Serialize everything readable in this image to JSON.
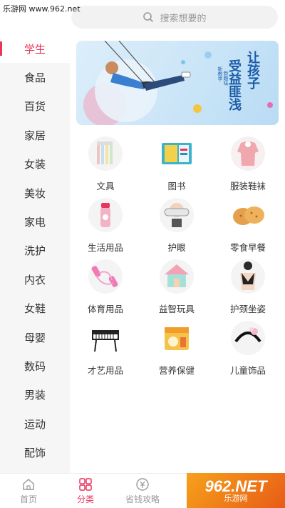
{
  "watermark_top": "乐游网 www.962.net",
  "search": {
    "placeholder": "搜索想要的"
  },
  "sidebar": {
    "items": [
      {
        "label": "学生",
        "active": true
      },
      {
        "label": "食品"
      },
      {
        "label": "百货"
      },
      {
        "label": "家居"
      },
      {
        "label": "女装"
      },
      {
        "label": "美妆"
      },
      {
        "label": "家电"
      },
      {
        "label": "洗护"
      },
      {
        "label": "内衣"
      },
      {
        "label": "女鞋"
      },
      {
        "label": "母婴"
      },
      {
        "label": "数码"
      },
      {
        "label": "男装"
      },
      {
        "label": "运动"
      },
      {
        "label": "配饰"
      }
    ]
  },
  "banner": {
    "line1": "让孩子",
    "line2": "受益匪浅",
    "small1": "新教学",
    "small2": "新趣味"
  },
  "categories": [
    {
      "label": "文具",
      "icon": "pens-icon"
    },
    {
      "label": "图书",
      "icon": "books-icon"
    },
    {
      "label": "服装鞋袜",
      "icon": "coat-icon"
    },
    {
      "label": "生活用品",
      "icon": "bottle-icon"
    },
    {
      "label": "护眼",
      "icon": "eye-massager-icon"
    },
    {
      "label": "零食早餐",
      "icon": "biscuits-icon"
    },
    {
      "label": "体育用品",
      "icon": "jump-rope-icon"
    },
    {
      "label": "益智玩具",
      "icon": "toy-house-icon"
    },
    {
      "label": "护颈坐姿",
      "icon": "posture-brace-icon"
    },
    {
      "label": "才艺用品",
      "icon": "keyboard-icon"
    },
    {
      "label": "营养保健",
      "icon": "milk-powder-icon"
    },
    {
      "label": "儿童饰品",
      "icon": "headband-icon"
    }
  ],
  "tabbar": {
    "tabs": [
      {
        "label": "首页",
        "icon": "home-icon"
      },
      {
        "label": "分类",
        "icon": "category-icon",
        "active": true
      },
      {
        "label": "省钱攻略",
        "icon": "money-icon"
      }
    ]
  },
  "watermark_corner": {
    "big": "962.NET",
    "small": "乐游网"
  },
  "colors": {
    "accent": "#e8355b",
    "sidebar_bg": "#f6f6f6",
    "banner_text": "#1a5aa8"
  }
}
